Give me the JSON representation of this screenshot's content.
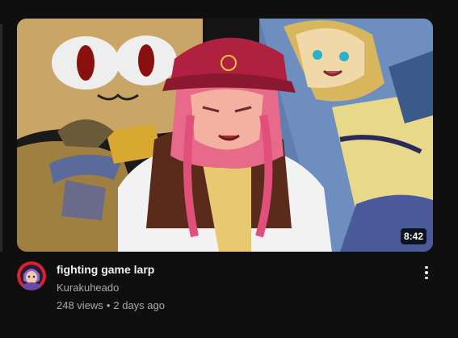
{
  "video": {
    "title": "fighting game larp",
    "channel": "Kurakuheado",
    "views": "248 views",
    "age": "2 days ago",
    "separator": "•",
    "duration": "8:42"
  },
  "icons": {
    "more_actions": "more-vert-icon"
  },
  "colors": {
    "background": "#0f0f0f",
    "title": "#f1f1f1",
    "secondary_text": "#aaaaaa",
    "avatar_ring": "#e0202a"
  }
}
